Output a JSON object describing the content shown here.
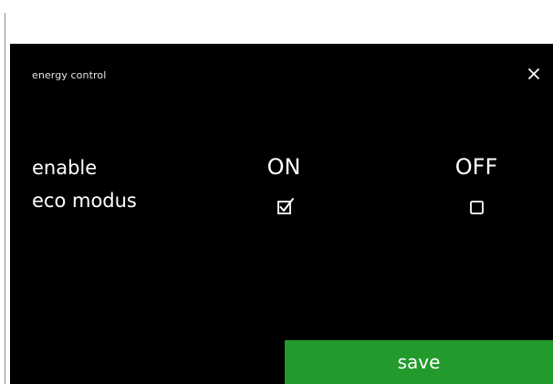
{
  "screen": {
    "title": "energy control",
    "setting": {
      "label_line1": "enable",
      "label_line2": "eco modus"
    },
    "options": [
      {
        "label": "ON",
        "checked": true
      },
      {
        "label": "OFF",
        "checked": false
      }
    ],
    "save_label": "save"
  },
  "icons": {
    "close": "close-icon",
    "checkbox_checked": "checkbox-checked-icon",
    "checkbox_unchecked": "checkbox-unchecked-icon"
  },
  "colors": {
    "screen_bg": "#000000",
    "text": "#ffffff",
    "save_button": "#229a2c"
  }
}
